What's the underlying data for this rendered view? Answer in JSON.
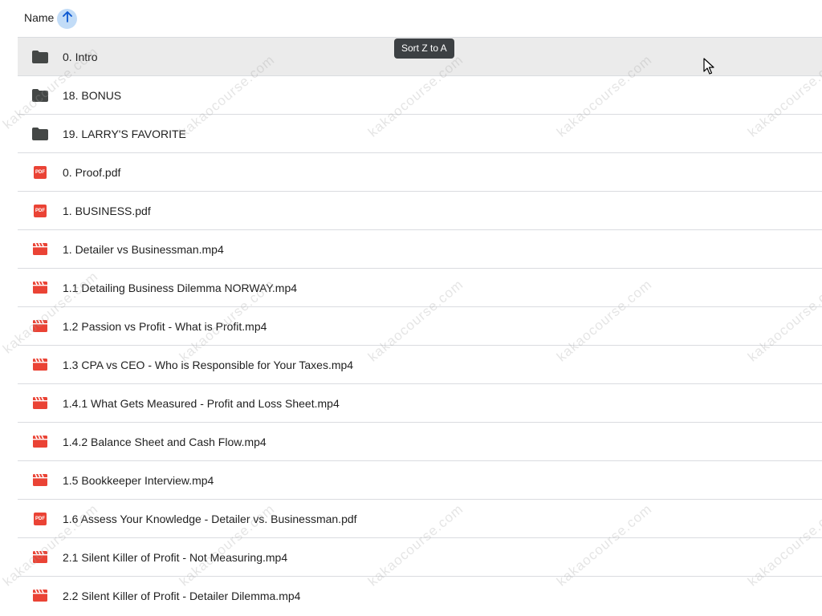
{
  "header": {
    "name_label": "Name",
    "sort_icon": "arrow-up-icon",
    "tooltip": "Sort Z to A"
  },
  "colors": {
    "folder": "#444746",
    "pdf": "#ea4335",
    "video": "#ea4335",
    "sort_button_bg": "#c2dcf7",
    "row_hover": "#ebebeb",
    "divider": "#dadce0"
  },
  "watermark_text": "kakaocourse.com",
  "files": [
    {
      "name": "0. Intro",
      "type": "folder",
      "icon": "folder-icon"
    },
    {
      "name": "18. BONUS",
      "type": "folder",
      "icon": "folder-icon"
    },
    {
      "name": "19. LARRY'S FAVORITE",
      "type": "folder",
      "icon": "folder-icon"
    },
    {
      "name": "0. Proof.pdf",
      "type": "pdf",
      "icon": "pdf-icon"
    },
    {
      "name": "1. BUSINESS.pdf",
      "type": "pdf",
      "icon": "pdf-icon"
    },
    {
      "name": "1. Detailer vs Businessman.mp4",
      "type": "video",
      "icon": "video-icon"
    },
    {
      "name": "1.1 Detailing Business Dilemma NORWAY.mp4",
      "type": "video",
      "icon": "video-icon"
    },
    {
      "name": "1.2 Passion vs Profit - What is Profit.mp4",
      "type": "video",
      "icon": "video-icon"
    },
    {
      "name": "1.3 CPA vs CEO - Who is Responsible for Your Taxes.mp4",
      "type": "video",
      "icon": "video-icon"
    },
    {
      "name": "1.4.1 What Gets Measured - Profit and Loss Sheet.mp4",
      "type": "video",
      "icon": "video-icon"
    },
    {
      "name": "1.4.2 Balance Sheet and Cash Flow.mp4",
      "type": "video",
      "icon": "video-icon"
    },
    {
      "name": "1.5 Bookkeeper Interview.mp4",
      "type": "video",
      "icon": "video-icon"
    },
    {
      "name": "1.6 Assess Your Knowledge - Detailer vs. Businessman.pdf",
      "type": "pdf",
      "icon": "pdf-icon"
    },
    {
      "name": "2.1 Silent Killer of Profit - Not Measuring.mp4",
      "type": "video",
      "icon": "video-icon"
    },
    {
      "name": "2.2 Silent Killer of Profit - Detailer Dilemma.mp4",
      "type": "video",
      "icon": "video-icon"
    }
  ]
}
